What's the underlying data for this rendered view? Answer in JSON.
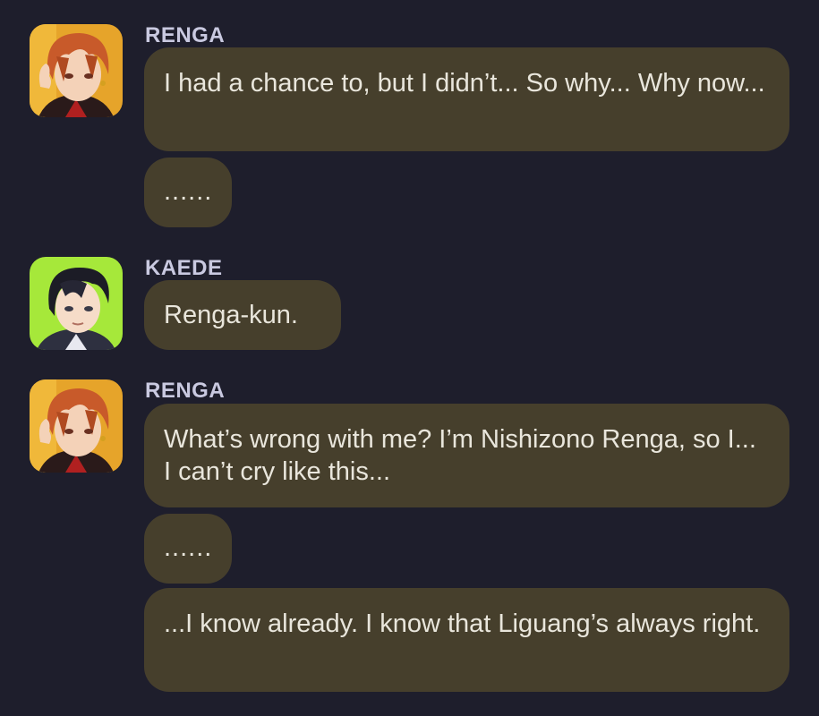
{
  "messages": [
    {
      "speaker": "RENGA",
      "bubbles": [
        "I had a chance to, but I didn’t... So why... Why now...",
        "......"
      ]
    },
    {
      "speaker": "KAEDE",
      "bubbles": [
        "Renga-kun."
      ]
    },
    {
      "speaker": "RENGA",
      "bubbles": [
        "What’s wrong with me? I’m Nishizono Renga, so I... I can’t cry like this...",
        "......",
        "...I know already. I know that Liguang’s always right."
      ]
    }
  ],
  "avatars": {
    "renga": {
      "icon": "renga-avatar",
      "hair_color": "#c85a2a",
      "bg_color": "#e6a42a"
    },
    "kaede": {
      "icon": "kaede-avatar",
      "hair_color": "#1c1c26",
      "bg_color": "#a6e83a"
    }
  },
  "colors": {
    "background": "#1e1e2c",
    "bubble": "#463f2c",
    "name": "#c9c9e0",
    "text": "#e9e6dc"
  }
}
